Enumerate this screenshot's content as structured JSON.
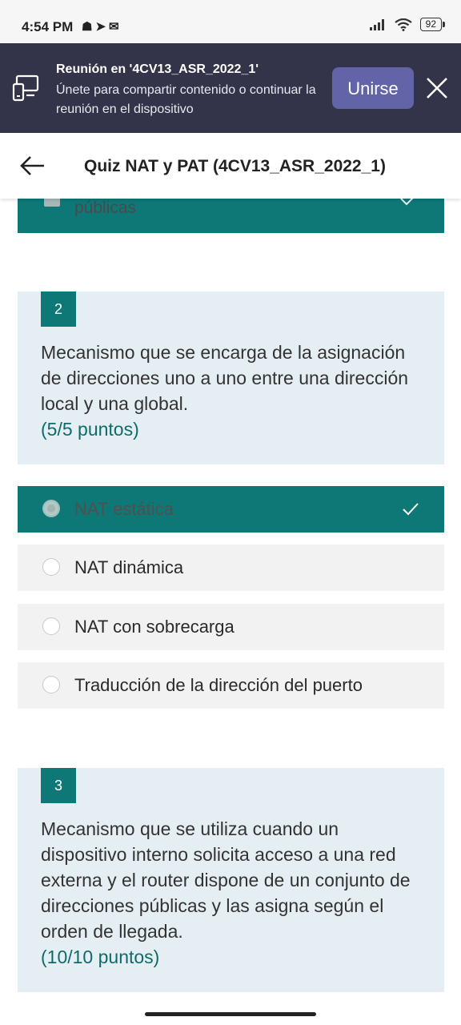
{
  "status_bar": {
    "time": "4:54 PM",
    "battery": "92",
    "left_icons": [
      "discord-icon",
      "telegram-icon",
      "outlook-icon"
    ],
    "right_icons": [
      "signal-icon",
      "wifi-icon",
      "battery-icon"
    ]
  },
  "meeting_banner": {
    "title": "Reunión en '4CV13_ASR_2022_1'",
    "text": "Únete para compartir contenido o continuar la reunión en el dispositivo",
    "join_label": "Unirse",
    "accent_color": "#6264a7",
    "background_color": "#33344a"
  },
  "header": {
    "title": "Quiz NAT y PAT (4CV13_ASR_2022_1)"
  },
  "previous_option": {
    "label": "públicas"
  },
  "questions": [
    {
      "number": "2",
      "text": "Mecanismo que se encarga de la asignación de direcciones uno a uno entre una dirección local y una global.",
      "points": "(5/5 puntos)",
      "options": [
        {
          "label": "NAT estática",
          "selected": true,
          "correct": true
        },
        {
          "label": "NAT dinámica",
          "selected": false
        },
        {
          "label": "NAT con sobrecarga",
          "selected": false
        },
        {
          "label": "Traducción de la dirección del puerto",
          "selected": false
        }
      ]
    },
    {
      "number": "3",
      "text": "Mecanismo que se utiliza cuando un dispositivo interno solicita acceso a una red externa y el router dispone de un conjunto de direcciones públicas y las asigna según el orden de llegada.",
      "points": "(10/10 puntos)"
    }
  ],
  "colors": {
    "teal": "#0e7877",
    "card_background": "#e5eef2",
    "option_background": "#f2f2f2"
  }
}
